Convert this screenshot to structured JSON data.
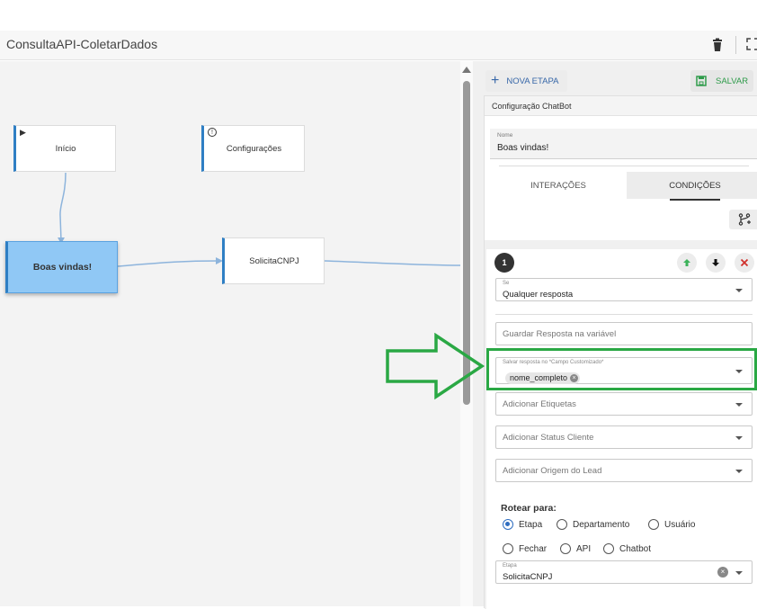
{
  "header": {
    "title": "ConsultaAPI-ColetarDados",
    "trash_icon": "trash-icon",
    "expand_icon": "fullscreen-icon"
  },
  "flow": {
    "nodes": [
      {
        "label": "Início",
        "icon": "play-icon"
      },
      {
        "label": "Configurações",
        "icon": "info-icon"
      },
      {
        "label": "Boas vindas!",
        "active": true
      },
      {
        "label": "SolicitaCNPJ"
      }
    ]
  },
  "toolbar": {
    "new_step": "NOVA ETAPA",
    "save": "SALVAR"
  },
  "panel": {
    "header": "Configuração ChatBot",
    "name_label": "Nome",
    "name_value": "Boas vindas!",
    "tabs": {
      "interactions": "INTERAÇÕES",
      "conditions": "CONDIÇÕES"
    },
    "condition": {
      "number": "1",
      "if_label": "Se",
      "if_value": "Qualquer resposta",
      "store_var_placeholder": "Guardar Resposta na variável",
      "custom_field_label": "Salvar resposta no *Campo Customizado*",
      "custom_field_chip": "nome_completo",
      "tags_placeholder": "Adicionar Etiquetas",
      "status_placeholder": "Adicionar Status Cliente",
      "origin_placeholder": "Adicionar Origem do Lead",
      "route_label": "Rotear para:",
      "route_options": [
        "Etapa",
        "Departamento",
        "Usuário",
        "Fechar",
        "API",
        "Chatbot"
      ],
      "route_selected": "Etapa",
      "step_label": "Etapa",
      "step_value": "SolicitaCNPJ"
    }
  },
  "colors": {
    "accent": "#2f7fc4",
    "highlight": "#2aa844",
    "save": "#2e9b4a",
    "active_node": "#90c8f5"
  }
}
